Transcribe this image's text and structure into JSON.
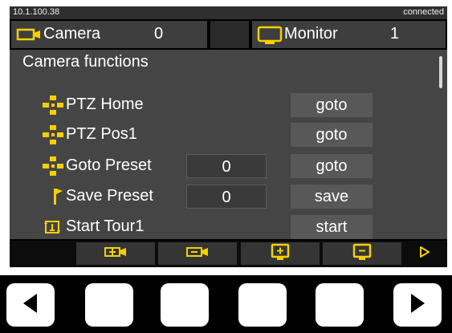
{
  "status": {
    "ip": "10.1.100.38",
    "connection": "connected"
  },
  "devices": {
    "camera": {
      "label": "Camera",
      "value": "0",
      "icon": "camera-icon"
    },
    "monitor": {
      "label": "Monitor",
      "value": "1",
      "icon": "monitor-icon"
    }
  },
  "section_title": "Camera functions",
  "functions": [
    {
      "label": "PTZ Home",
      "value": "",
      "action": "goto",
      "icon": "ptz-home-icon"
    },
    {
      "label": "PTZ Pos1",
      "value": "",
      "action": "goto",
      "icon": "ptz-pos1-icon"
    },
    {
      "label": "Goto Preset",
      "value": "0",
      "action": "goto",
      "icon": "ptz-preset-icon"
    },
    {
      "label": "Save Preset",
      "value": "0",
      "action": "save",
      "icon": "flag-icon"
    },
    {
      "label": "Start Tour1",
      "value": "",
      "action": "start",
      "icon": "tour-icon"
    }
  ],
  "bottom_buttons": [
    {
      "icon": "camera-next-icon"
    },
    {
      "icon": "camera-prev-icon"
    },
    {
      "icon": "monitor-next-icon"
    },
    {
      "icon": "monitor-prev-icon"
    },
    {
      "icon": "play-icon"
    }
  ],
  "hardware_keys": [
    {
      "icon": "left-arrow-icon"
    },
    {
      "icon": "blank-key"
    },
    {
      "icon": "blank-key"
    },
    {
      "icon": "blank-key"
    },
    {
      "icon": "blank-key"
    },
    {
      "icon": "right-arrow-icon"
    }
  ],
  "colors": {
    "accent": "#f5d000",
    "panel": "#454545",
    "button": "#585858",
    "background": "#000000"
  }
}
